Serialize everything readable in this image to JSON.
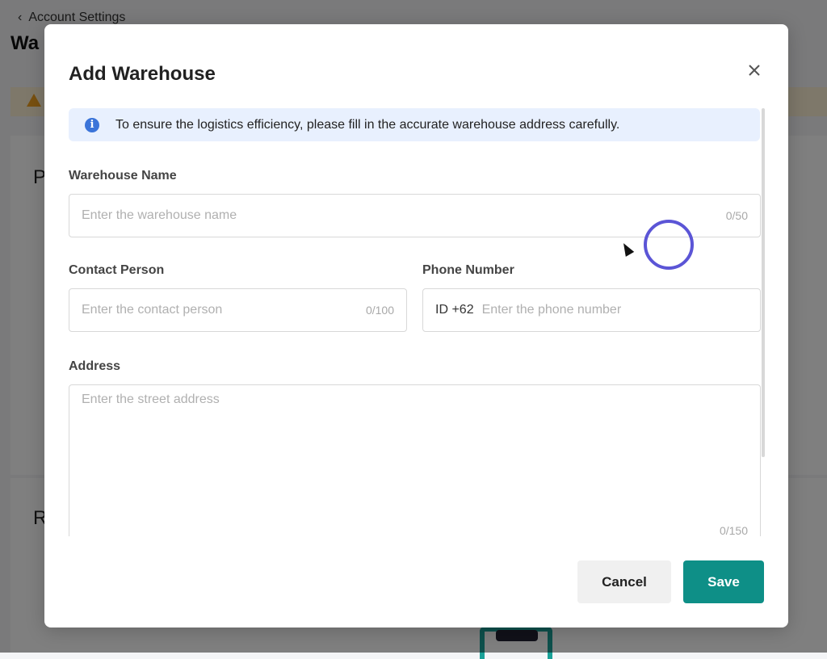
{
  "background": {
    "back_label": "Account Settings",
    "page_title": "Wa",
    "card1_label": "P",
    "card2_label": "R"
  },
  "modal": {
    "title": "Add Warehouse",
    "info_banner": "To ensure the logistics efficiency, please fill in the accurate warehouse address carefully.",
    "warehouse_name": {
      "label": "Warehouse Name",
      "placeholder": "Enter the warehouse name",
      "value": "",
      "counter": "0/50"
    },
    "contact_person": {
      "label": "Contact Person",
      "placeholder": "Enter the contact person",
      "value": "",
      "counter": "0/100"
    },
    "phone_number": {
      "label": "Phone Number",
      "prefix": "ID +62",
      "placeholder": "Enter the phone number",
      "value": ""
    },
    "address": {
      "label": "Address",
      "placeholder": "Enter the street address",
      "value": "",
      "counter": "0/150"
    },
    "buttons": {
      "cancel": "Cancel",
      "save": "Save"
    }
  },
  "colors": {
    "primary": "#0e8f87",
    "info_bg": "#e8f0fe",
    "info_icon": "#3b74d9",
    "cursor_ring": "#5b55d6"
  },
  "icons": {
    "close": "close-icon",
    "info": "info-icon",
    "back": "chevron-left-icon",
    "warning": "warning-icon"
  }
}
